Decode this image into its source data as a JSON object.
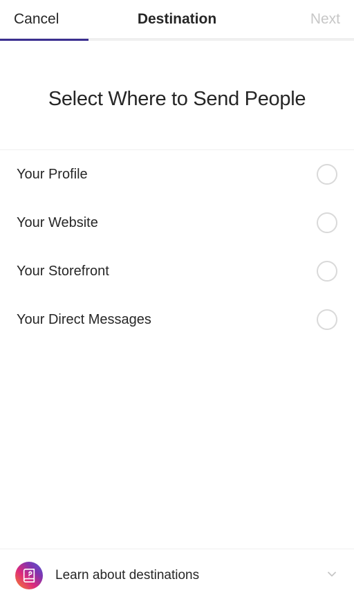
{
  "header": {
    "cancel": "Cancel",
    "title": "Destination",
    "next": "Next"
  },
  "hero": {
    "heading": "Select Where to Send People"
  },
  "options": [
    {
      "label": "Your Profile"
    },
    {
      "label": "Your Website"
    },
    {
      "label": "Your Storefront"
    },
    {
      "label": "Your Direct Messages"
    }
  ],
  "footer": {
    "learn_label": "Learn about destinations"
  }
}
